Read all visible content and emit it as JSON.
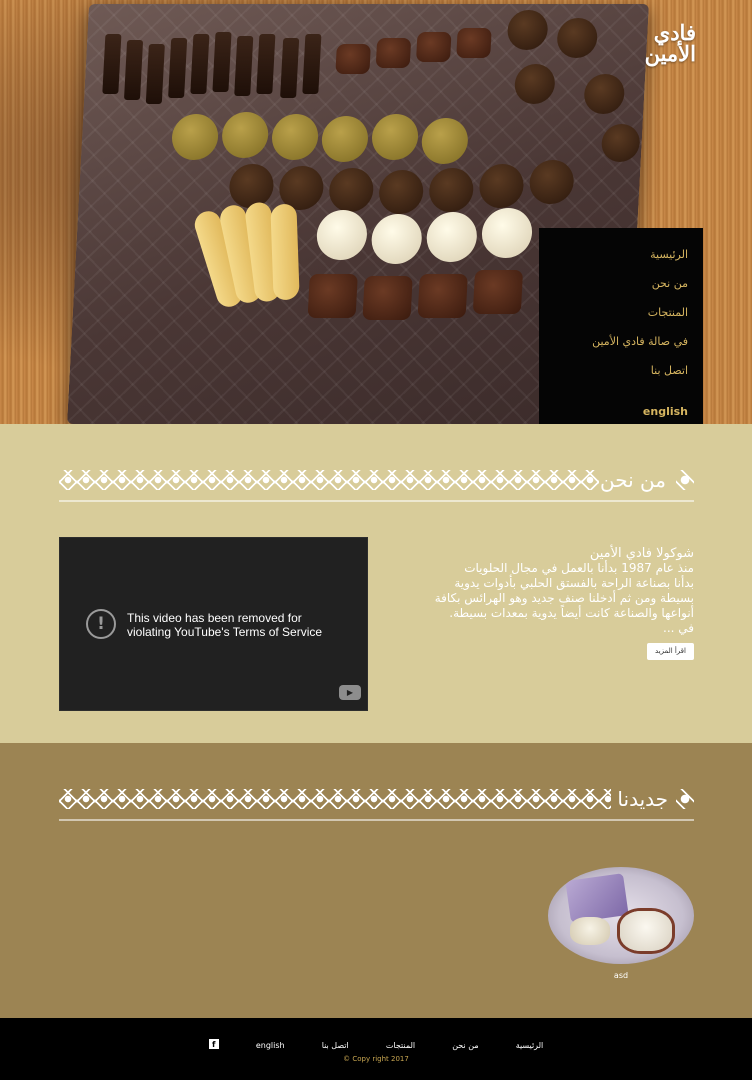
{
  "brand": {
    "logo_line1": "فادي",
    "logo_line2": "الأمين"
  },
  "nav": {
    "items": [
      {
        "label": "الرئيسية"
      },
      {
        "label": "من نحن"
      },
      {
        "label": "المنتجات"
      },
      {
        "label": "في صالة فادي الأمين"
      },
      {
        "label": "اتصل بنا"
      }
    ],
    "language": "english"
  },
  "about": {
    "heading": "من نحن",
    "name": "شوكولا فادي الأمين",
    "lines": [
      "منذ عام 1987 بدأنا بالعمل في مجال الحلويات",
      "بدأنا بصناعة الراحة بالفستق الحلبي بأدوات يدوية",
      "بسيطة ومن ثم أدخلنا صنف جديد وهو الهرائس بكافة",
      "أنواعها والصناعة كانت أيضاً يدوية بمعدات بسيطة.",
      "في ..."
    ],
    "more_label": "اقرأ المزيد",
    "video_message_line1": "This video has been removed for",
    "video_message_line2": "violating YouTube's Terms of Service"
  },
  "new": {
    "heading": "جديدنا",
    "products": [
      {
        "caption": "asd"
      }
    ]
  },
  "footer": {
    "links": [
      "الرئيسية",
      "من نحن",
      "المنتجات",
      "اتصل بنا",
      "english"
    ],
    "copyright": "© Copy right 2017"
  },
  "colors": {
    "section1_bg": "#d8cc9a",
    "section2_bg": "#9c8453",
    "nav_bg": "#050505",
    "nav_text": "#d6b560",
    "footer_bg": "#000000",
    "copyright_text": "#c8a651"
  },
  "icons": [
    "facebook-icon",
    "warning-icon",
    "youtube-icon"
  ]
}
